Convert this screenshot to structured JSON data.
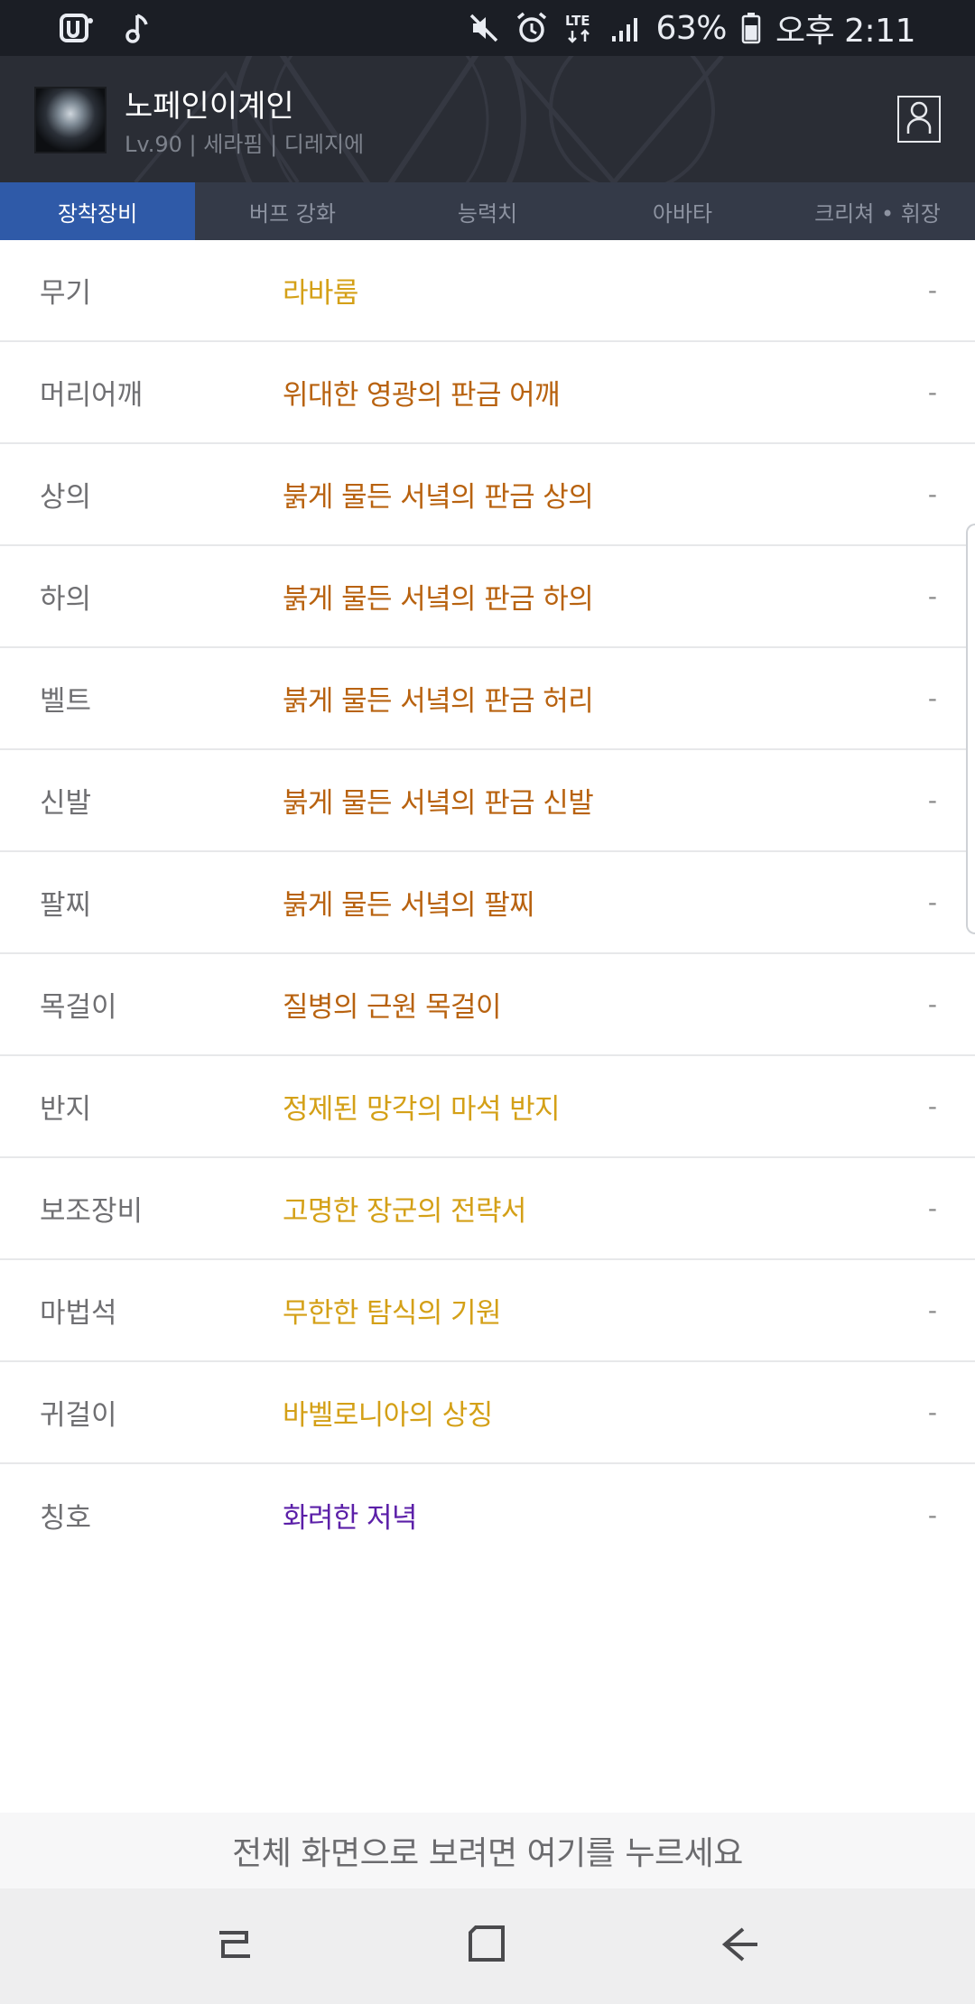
{
  "status_bar": {
    "battery": "63%",
    "time": "오후 2:11",
    "network": "LTE",
    "icons": [
      "app-icon",
      "music-note-icon",
      "mute-icon",
      "alarm-icon",
      "lte-icon",
      "signal-icon",
      "battery-icon"
    ]
  },
  "profile": {
    "name": "노페인이계인",
    "info": "Lv.90 | 세라핌 | 디레지에"
  },
  "tabs": [
    {
      "label": "장착장비",
      "active": true
    },
    {
      "label": "버프 강화",
      "active": false
    },
    {
      "label": "능력치",
      "active": false
    },
    {
      "label": "아바타",
      "active": false
    },
    {
      "label": "크리쳐 • 휘장",
      "active": false
    }
  ],
  "equipment": [
    {
      "slot": "무기",
      "item": "라바룸",
      "color": "#d4a017",
      "value": "-"
    },
    {
      "slot": "머리어깨",
      "item": "위대한 영광의 판금 어깨",
      "color": "#b8620f",
      "value": "-"
    },
    {
      "slot": "상의",
      "item": "붉게 물든 서녘의 판금 상의",
      "color": "#b8620f",
      "value": "-"
    },
    {
      "slot": "하의",
      "item": "붉게 물든 서녘의 판금 하의",
      "color": "#b8620f",
      "value": "-"
    },
    {
      "slot": "벨트",
      "item": "붉게 물든 서녘의 판금 허리",
      "color": "#b8620f",
      "value": "-"
    },
    {
      "slot": "신발",
      "item": "붉게 물든 서녘의 판금 신발",
      "color": "#b8620f",
      "value": "-"
    },
    {
      "slot": "팔찌",
      "item": "붉게 물든 서녘의 팔찌",
      "color": "#b8620f",
      "value": "-"
    },
    {
      "slot": "목걸이",
      "item": "질병의 근원 목걸이",
      "color": "#b8620f",
      "value": "-"
    },
    {
      "slot": "반지",
      "item": "정제된 망각의 마석 반지",
      "color": "#d4a017",
      "value": "-"
    },
    {
      "slot": "보조장비",
      "item": "고명한 장군의 전략서",
      "color": "#d4a017",
      "value": "-"
    },
    {
      "slot": "마법석",
      "item": "무한한 탐식의 기원",
      "color": "#d4a017",
      "value": "-"
    },
    {
      "slot": "귀걸이",
      "item": "바벨로니아의 상징",
      "color": "#d4a017",
      "value": "-"
    },
    {
      "slot": "칭호",
      "item": "화려한 저녁",
      "color": "#5b1fa8",
      "value": "-"
    }
  ],
  "fullscreen_banner": "전체 화면으로 보려면 여기를 누르세요",
  "nav": {
    "icons": [
      "recent-apps-icon",
      "home-icon",
      "back-icon"
    ]
  }
}
